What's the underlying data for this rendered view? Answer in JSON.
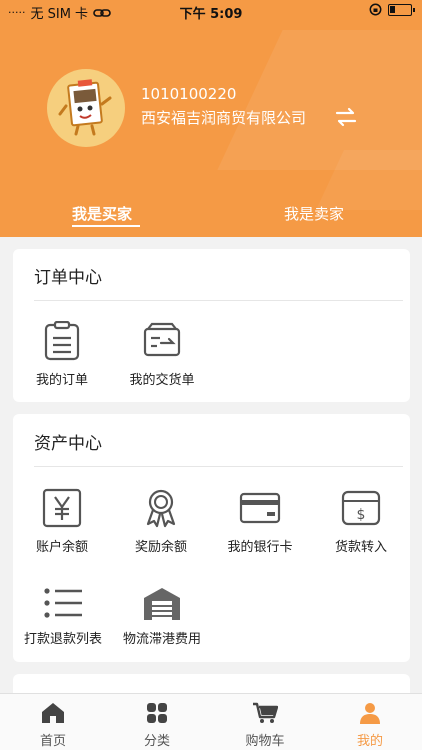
{
  "status_bar": {
    "carrier": "无 SIM 卡",
    "time": "下午 5:09",
    "battery_level": 0.25
  },
  "profile": {
    "account_id": "1010100220",
    "company_name": "西安福吉润商贸有限公司",
    "avatar_icon": "mascot-avatar-icon",
    "switch_icon": "switch-arrows-icon"
  },
  "role_tabs": {
    "buyer": "我是买家",
    "seller": "我是卖家",
    "active": "buyer"
  },
  "order_center": {
    "title": "订单中心",
    "items": [
      {
        "label": "我的订单",
        "icon": "order-list-icon"
      },
      {
        "label": "我的交货单",
        "icon": "delivery-note-icon"
      }
    ]
  },
  "asset_center": {
    "title": "资产中心",
    "items": [
      {
        "label": "账户余额",
        "icon": "yen-balance-icon"
      },
      {
        "label": "奖励余额",
        "icon": "award-ribbon-icon"
      },
      {
        "label": "我的银行卡",
        "icon": "bank-card-icon"
      },
      {
        "label": "货款转入",
        "icon": "dollar-transfer-icon"
      },
      {
        "label": "打款退款列表",
        "icon": "list-icon"
      },
      {
        "label": "物流滞港费用",
        "icon": "warehouse-icon"
      }
    ]
  },
  "bottom_nav": {
    "items": [
      {
        "label": "首页",
        "icon": "home-icon"
      },
      {
        "label": "分类",
        "icon": "category-grid-icon"
      },
      {
        "label": "购物车",
        "icon": "cart-icon"
      },
      {
        "label": "我的",
        "icon": "user-icon"
      }
    ],
    "active": "我的"
  },
  "colors": {
    "brand_orange": "#f59a45",
    "page_background": "#f2f2f2",
    "icon_gray": "#555555"
  }
}
